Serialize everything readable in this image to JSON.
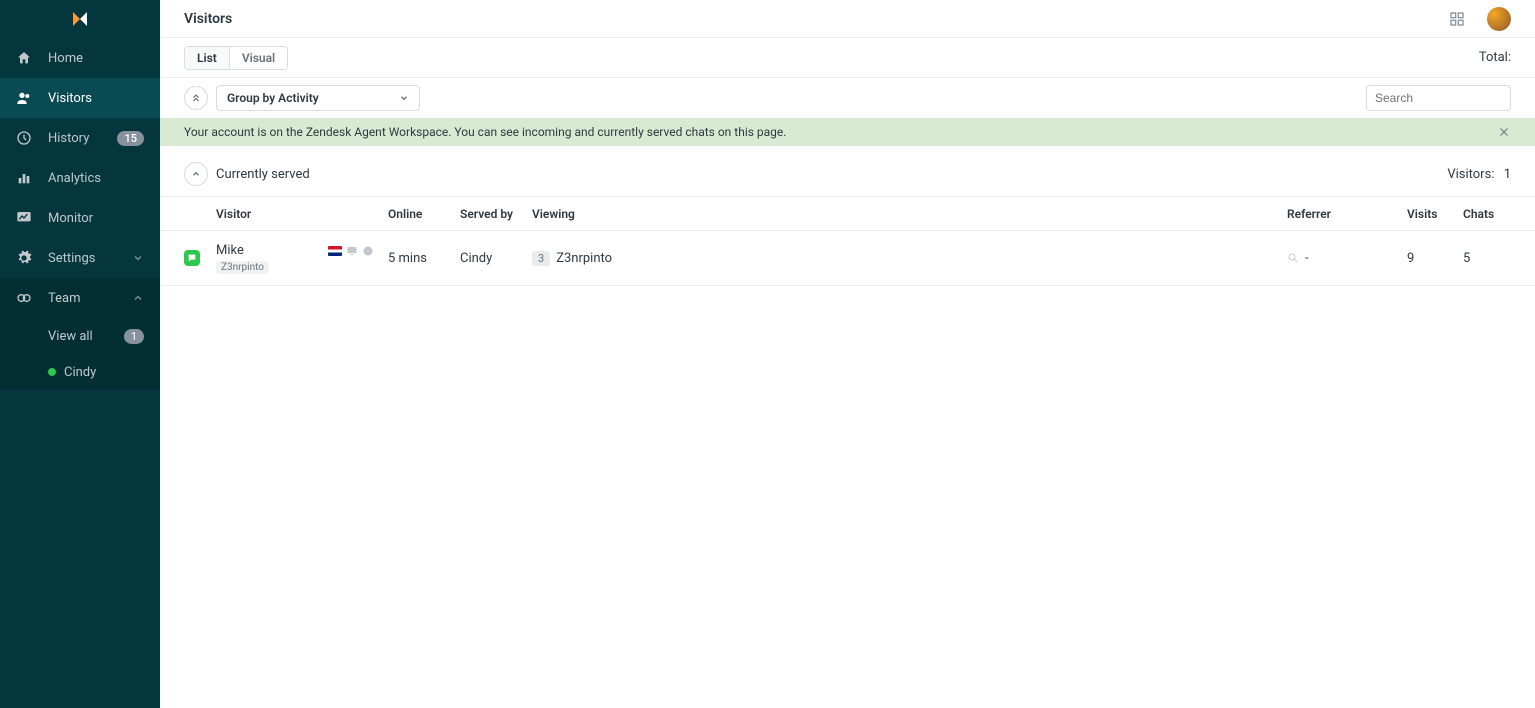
{
  "page": {
    "title": "Visitors"
  },
  "sidebar": {
    "items": [
      {
        "label": "Home"
      },
      {
        "label": "Visitors"
      },
      {
        "label": "History",
        "badge": "15"
      },
      {
        "label": "Analytics"
      },
      {
        "label": "Monitor"
      },
      {
        "label": "Settings"
      },
      {
        "label": "Team"
      }
    ],
    "team": {
      "view_all": {
        "label": "View all",
        "badge": "1"
      },
      "members": [
        {
          "name": "Cindy"
        }
      ]
    }
  },
  "controls": {
    "tabs": {
      "list": "List",
      "visual": "Visual"
    },
    "total_label": "Total:"
  },
  "toolbar": {
    "group_by": "Group by Activity",
    "search_placeholder": "Search"
  },
  "banner": {
    "text": "Your account is on the Zendesk Agent Workspace. You can see incoming and currently served chats on this page."
  },
  "section": {
    "title": "Currently served",
    "visitors_label": "Visitors:",
    "visitors_count": "1"
  },
  "table": {
    "headers": {
      "visitor": "Visitor",
      "online": "Online",
      "served_by": "Served by",
      "viewing": "Viewing",
      "referrer": "Referrer",
      "visits": "Visits",
      "chats": "Chats"
    },
    "rows": [
      {
        "name": "Mike",
        "tag": "Z3nrpinto",
        "online": "5 mins",
        "served_by": "Cindy",
        "page_count": "3",
        "viewing": "Z3nrpinto",
        "referrer": "-",
        "visits": "9",
        "chats": "5"
      }
    ]
  }
}
